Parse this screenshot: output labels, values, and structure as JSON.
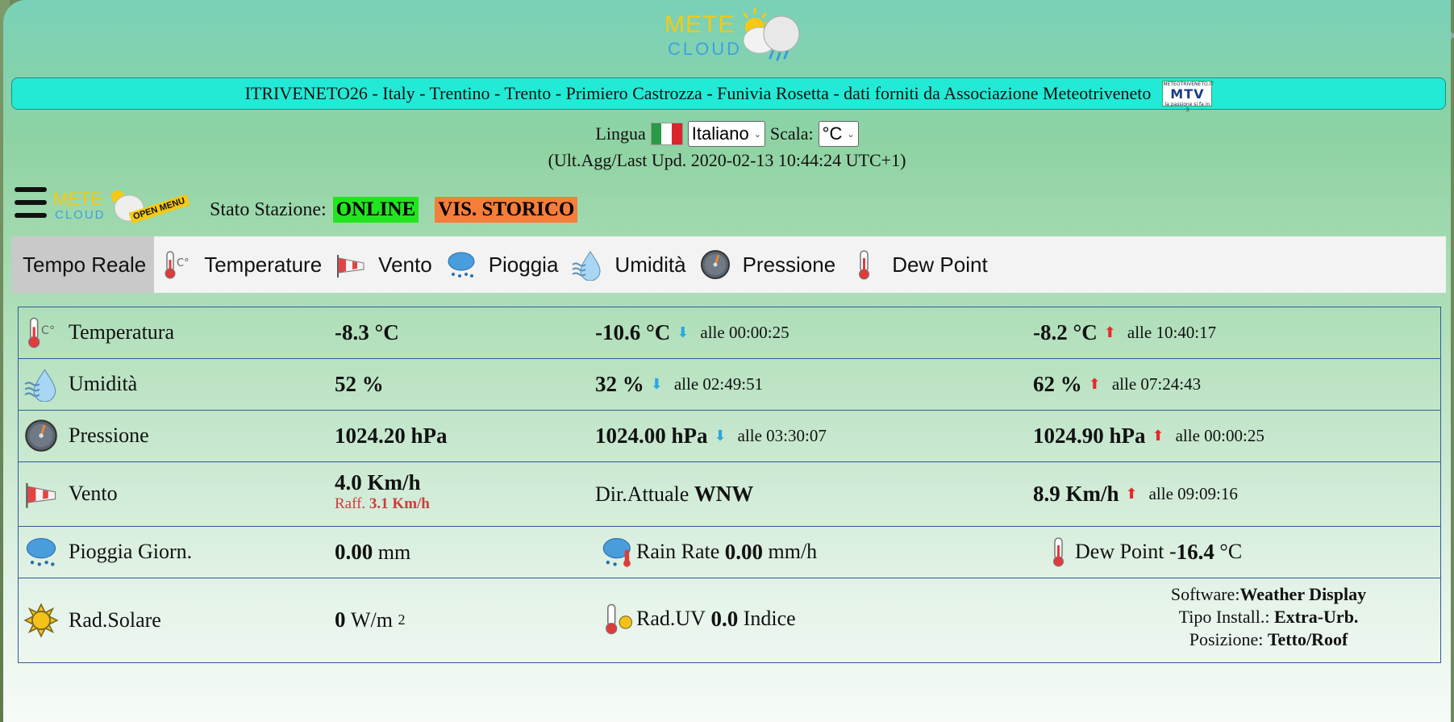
{
  "logo": {
    "line1": "METE",
    "line2": "CLOUD"
  },
  "station_bar": {
    "text": "ITRIVENETO26 - Italy - Trentino - Trento - Primiero Castrozza - Funivia Rosetta - dati forniti da Associazione Meteotriveneto",
    "badge_top": "METEOTRIVENETO.IT",
    "badge_main": "MTV",
    "badge_tagline": "la passione si fa in 3"
  },
  "language": {
    "label": "Lingua",
    "selected": "Italiano",
    "scale_label": "Scala:",
    "scale_selected": "°C"
  },
  "last_update": "(Ult.Agg/Last Upd. 2020-02-13 10:44:24  UTC+1)",
  "menu": {
    "logo_line1": "METE",
    "logo_line2": "CLOUD",
    "ribbon": "OPEN MENU"
  },
  "status": {
    "label": "Stato Stazione:",
    "online": "ONLINE",
    "history": "VIS. STORICO"
  },
  "tabs": [
    {
      "label": "Tempo Reale",
      "icon": "none"
    },
    {
      "label": "Temperature",
      "icon": "thermometer-icon"
    },
    {
      "label": "Vento",
      "icon": "windsock-icon"
    },
    {
      "label": "Pioggia",
      "icon": "rain-cloud-icon"
    },
    {
      "label": "Umidità",
      "icon": "humidity-drop-icon"
    },
    {
      "label": "Pressione",
      "icon": "barometer-icon"
    },
    {
      "label": "Dew Point",
      "icon": "thermometer-icon"
    }
  ],
  "colors": {
    "online": "#23e421",
    "history": "#f57e3a",
    "station_bar": "#22ead6",
    "arrow_down": "#29a8e0",
    "arrow_up": "#e52b2b"
  },
  "rows": {
    "temperature": {
      "label": "Temperatura",
      "current": "-8.3 °C",
      "min": "-10.6 °C",
      "min_time": "alle 00:00:25",
      "max": "-8.2 °C",
      "max_time": "alle 10:40:17"
    },
    "humidity": {
      "label": "Umidità",
      "current": "52 %",
      "min": "32 %",
      "min_time": "alle 02:49:51",
      "max": "62 %",
      "max_time": "alle 07:24:43"
    },
    "pressure": {
      "label": "Pressione",
      "current": "1024.20 hPa",
      "min": "1024.00 hPa",
      "min_time": "alle 03:30:07",
      "max": "1024.90 hPa",
      "max_time": "alle 00:00:25"
    },
    "wind": {
      "label": "Vento",
      "current": "4.0 Km/h",
      "gust_label": "Raff.",
      "gust": "3.1 Km/h",
      "dir_label": "Dir.Attuale",
      "dir": "WNW",
      "max": "8.9 Km/h",
      "max_time": "alle 09:09:16"
    },
    "rain": {
      "label": "Pioggia Giorn.",
      "value": "0.00",
      "unit": "mm",
      "rate_label": "Rain Rate",
      "rate_value": "0.00",
      "rate_unit": "mm/h",
      "dew_label": "Dew Point",
      "dew_sign": "-",
      "dew_value": "16.4",
      "dew_unit": "°C"
    },
    "solar": {
      "label": "Rad.Solare",
      "value": "0",
      "unit": "W/m",
      "unit_exp": "2",
      "uv_label": "Rad.UV",
      "uv_value": "0.0",
      "uv_unit": "Indice",
      "software_label": "Software:",
      "software": "Weather Display",
      "install_label": "Tipo Install.:",
      "install": "Extra-Urb.",
      "position_label": "Posizione:",
      "position": "Tetto/Roof"
    }
  }
}
